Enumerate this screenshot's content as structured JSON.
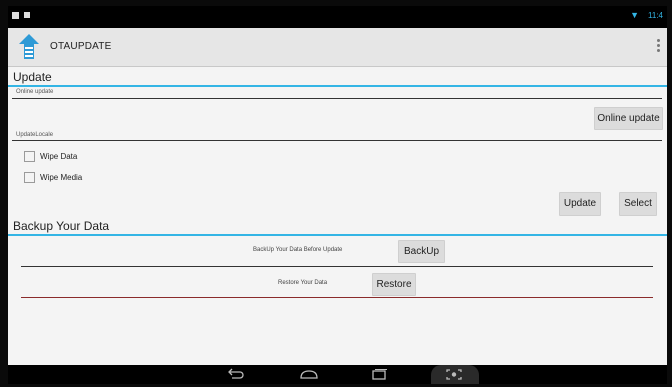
{
  "app": {
    "title": "OTAUPDATE"
  },
  "status_bar": {
    "time": "11:4"
  },
  "update_section": {
    "title": "Update",
    "online_label": "Online update",
    "online_button": "Online update",
    "locale_label": "UpdateLocale",
    "checkboxes": [
      {
        "label": "Wipe Data",
        "checked": false
      },
      {
        "label": "Wipe Media",
        "checked": false
      }
    ],
    "update_button": "Update",
    "select_button": "Select"
  },
  "backup_section": {
    "title": "Backup Your Data",
    "backup_label": "BackUp Your Data Before Update",
    "backup_button": "BackUp",
    "restore_label": "Restore Your Data",
    "restore_button": "Restore"
  },
  "nav_bar": {
    "icons": [
      "back-icon",
      "home-icon",
      "recents-icon",
      "screenshot-icon"
    ]
  },
  "colors": {
    "accent": "#33b5e5",
    "divider_red": "#8a2b2b"
  }
}
